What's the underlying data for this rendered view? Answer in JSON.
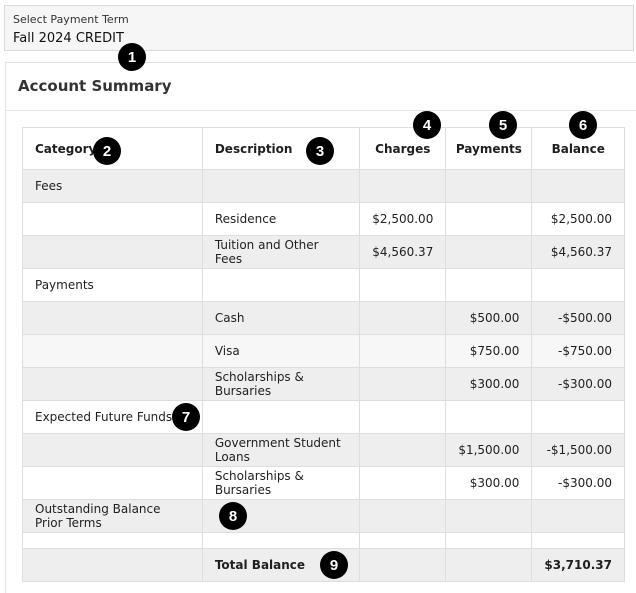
{
  "payment_term": {
    "label": "Select Payment Term",
    "value": "Fall 2024 CREDIT"
  },
  "summary": {
    "title": "Account Summary",
    "columns": {
      "category": "Category",
      "description": "Description",
      "charges": "Charges",
      "payments": "Payments",
      "balance": "Balance"
    },
    "rows": [
      {
        "category": "Fees",
        "description": "",
        "charges": "",
        "payments": "",
        "balance": ""
      },
      {
        "category": "",
        "description": "Residence",
        "charges": "$2,500.00",
        "payments": "",
        "balance": "$2,500.00"
      },
      {
        "category": "",
        "description": "Tuition and Other Fees",
        "charges": "$4,560.37",
        "payments": "",
        "balance": "$4,560.37"
      },
      {
        "category": "Payments",
        "description": "",
        "charges": "",
        "payments": "",
        "balance": ""
      },
      {
        "category": "",
        "description": "Cash",
        "charges": "",
        "payments": "$500.00",
        "balance": "-$500.00"
      },
      {
        "category": "",
        "description": "Visa",
        "charges": "",
        "payments": "$750.00",
        "balance": "-$750.00"
      },
      {
        "category": "",
        "description": "Scholarships & Bursaries",
        "charges": "",
        "payments": "$300.00",
        "balance": "-$300.00"
      },
      {
        "category": "Expected Future Funds",
        "description": "",
        "charges": "",
        "payments": "",
        "balance": ""
      },
      {
        "category": "",
        "description": "Government Student Loans",
        "charges": "",
        "payments": "$1,500.00",
        "balance": "-$1,500.00"
      },
      {
        "category": "",
        "description": "Scholarships & Bursaries",
        "charges": "",
        "payments": "$300.00",
        "balance": "-$300.00"
      },
      {
        "category": "Outstanding Balance Prior Terms",
        "description": "",
        "charges": "",
        "payments": "",
        "balance": ""
      }
    ],
    "total": {
      "label": "Total Balance",
      "balance": "$3,710.37"
    }
  },
  "markers": [
    "1",
    "2",
    "3",
    "4",
    "5",
    "6",
    "7",
    "8",
    "9"
  ]
}
